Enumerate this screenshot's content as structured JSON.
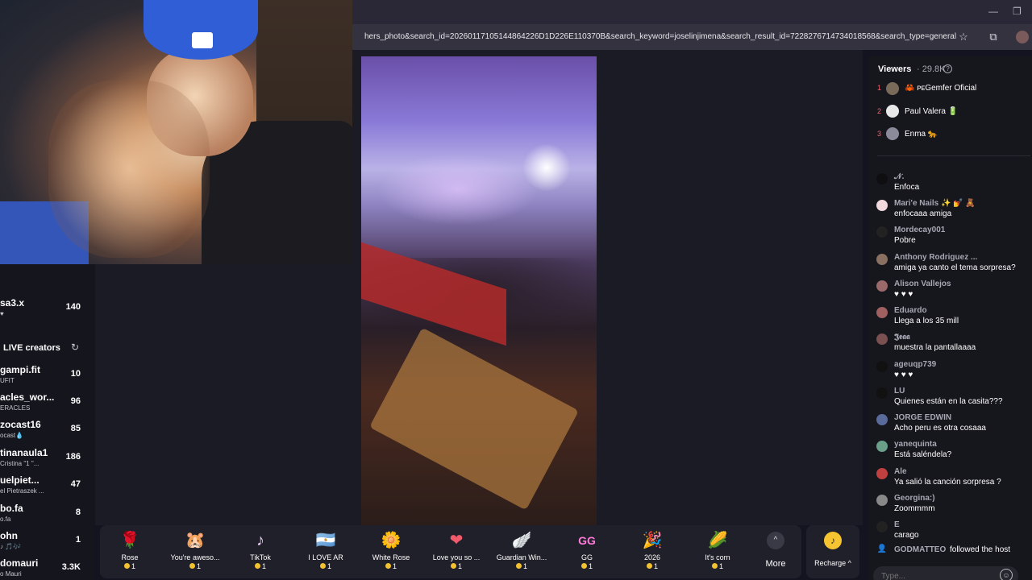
{
  "browser": {
    "url": "hers_photo&search_id=20260117105144864226D1D226E110370B&search_keyword=joselinjimena&search_result_id=7228276714734018568&search_type=general",
    "minimize": "—",
    "restore": "❐",
    "star_icon": "☆",
    "ext_icon": "⧉"
  },
  "sidebar": {
    "items": [
      {
        "name": "sa3.x",
        "sub": "♥",
        "count": "140"
      },
      {
        "name": "gampi.fit",
        "sub": "UFIT",
        "count": "10"
      },
      {
        "name": "acles_wor...",
        "sub": "ERACLES",
        "count": "96"
      },
      {
        "name": "zocast16",
        "sub": "ocast💧",
        "count": "85"
      },
      {
        "name": "tinanaula1",
        "sub": "Cristina \"1 \"...",
        "count": "186"
      },
      {
        "name": "uelpiet...",
        "sub": "el Pietraszek ...",
        "count": "47"
      },
      {
        "name": "bo.fa",
        "sub": "o.fa",
        "count": "8"
      },
      {
        "name": "ohn",
        "sub": "♪ 🎵🎶",
        "count": "1"
      },
      {
        "name": "domauri",
        "sub": "o Mauri",
        "count": "3.3K"
      }
    ],
    "live_heading": "LIVE creators",
    "refresh_icon": "↻"
  },
  "gifts": [
    {
      "name": "Rose",
      "price": "1",
      "icon": "🌹"
    },
    {
      "name": "You're aweso...",
      "price": "1",
      "icon": "🐹"
    },
    {
      "name": "TikTok",
      "price": "1",
      "icon": "♪"
    },
    {
      "name": "I LOVE AR",
      "price": "1",
      "icon": "🇦🇷"
    },
    {
      "name": "White Rose",
      "price": "1",
      "icon": "🌼"
    },
    {
      "name": "Love you so ...",
      "price": "1",
      "icon": "❤"
    },
    {
      "name": "Guardian Win...",
      "price": "1",
      "icon": "🪽"
    },
    {
      "name": "GG",
      "price": "1",
      "icon": "GG"
    },
    {
      "name": "2026",
      "price": "1",
      "icon": "🎉"
    },
    {
      "name": "It's corn",
      "price": "1",
      "icon": "🌽"
    }
  ],
  "more_label": "More",
  "recharge_label": "Recharge ^",
  "chat": {
    "viewers_label": "Viewers",
    "viewers_count": "· 29.8K",
    "top": [
      {
        "rank": "1",
        "name": "🦀 ᴘᴇGemfer Oficial",
        "color": "#7a6a5a"
      },
      {
        "rank": "2",
        "name": "Paul Valera 🔋",
        "color": "#e8e8e8"
      },
      {
        "rank": "3",
        "name": "Enma 🐆",
        "color": "#8a8a9a"
      }
    ],
    "messages": [
      {
        "user": "𝒩.",
        "text": "Enfoca",
        "color": "#111"
      },
      {
        "user": "Mari'e Nails ✨ 💅 🧸",
        "text": "enfocaaa amiga",
        "color": "#f0d8dc"
      },
      {
        "user": "Mordecay001",
        "text": "Pobre",
        "color": "#222"
      },
      {
        "user": "Anthony Rodriguez ...",
        "text": "amiga ya canto el tema sorpresa?",
        "color": "#8a7060"
      },
      {
        "user": "Alison Vallejos",
        "text": "♥ ♥ ♥",
        "color": "#9a6a6a"
      },
      {
        "user": "Eduardo",
        "text": "Llega a los 35 mill",
        "color": "#a06060"
      },
      {
        "user": "𝕵𝖊𝖆𝖆",
        "text": "muestra la pantallaaaa",
        "color": "#7a5050"
      },
      {
        "user": "ageuqp739",
        "text": "♥ ♥ ♥",
        "color": "#111"
      },
      {
        "user": "LU",
        "text": "Quienes están en la casita???",
        "color": "#111"
      },
      {
        "user": "JORGE EDWIN",
        "text": "Acho peru es otra cosaaa",
        "color": "#5a6a9a"
      },
      {
        "user": "yanequinta",
        "text": "Está saléndela?",
        "color": "#6aa08a"
      },
      {
        "user": "Ale",
        "text": "Ya salió la canción sorpresa ?",
        "color": "#c04040"
      },
      {
        "user": "Georgina:)",
        "text": "Zoommmm",
        "color": "#888"
      },
      {
        "user": "E",
        "text": "carago",
        "color": "#222"
      }
    ],
    "follow": {
      "user": "GODMATTEO",
      "text": "followed the host",
      "icon": "👤"
    },
    "input_placeholder": "Type...",
    "emoji_icon": "☺"
  }
}
